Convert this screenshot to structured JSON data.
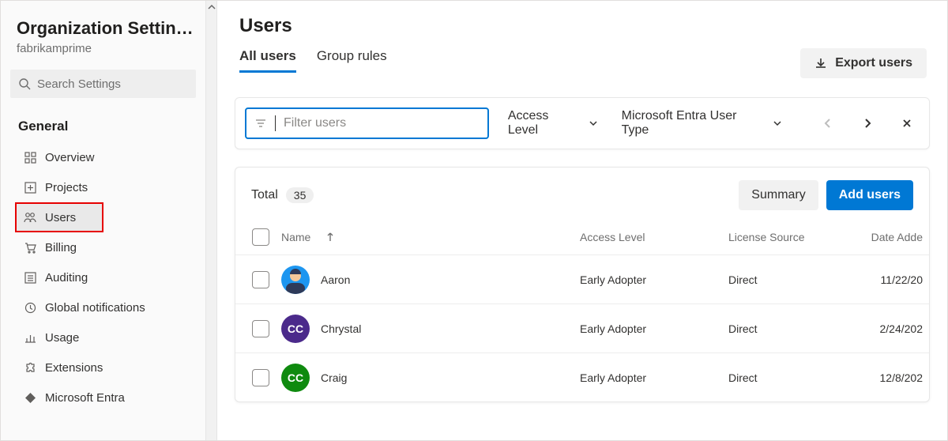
{
  "sidebar": {
    "title": "Organization Settin…",
    "subtitle": "fabrikamprime",
    "search_placeholder": "Search Settings",
    "section_label": "General",
    "items": [
      {
        "label": "Overview",
        "icon": "grid"
      },
      {
        "label": "Projects",
        "icon": "plus-box"
      },
      {
        "label": "Users",
        "icon": "people",
        "selected": true
      },
      {
        "label": "Billing",
        "icon": "cart"
      },
      {
        "label": "Auditing",
        "icon": "list"
      },
      {
        "label": "Global notifications",
        "icon": "clock"
      },
      {
        "label": "Usage",
        "icon": "bar-chart"
      },
      {
        "label": "Extensions",
        "icon": "puzzle"
      },
      {
        "label": "Microsoft Entra",
        "icon": "diamond"
      }
    ]
  },
  "page": {
    "title": "Users",
    "tabs": [
      {
        "label": "All users",
        "active": true
      },
      {
        "label": "Group rules"
      }
    ],
    "export_label": "Export users"
  },
  "filter": {
    "placeholder": "Filter users",
    "access_level_label": "Access Level",
    "entra_label": "Microsoft Entra User Type"
  },
  "table": {
    "total_label": "Total",
    "total_count": "35",
    "summary_label": "Summary",
    "add_label": "Add users",
    "columns": {
      "name": "Name",
      "access": "Access Level",
      "source": "License Source",
      "date": "Date Adde"
    },
    "rows": [
      {
        "name": "Aaron",
        "access": "Early Adopter",
        "source": "Direct",
        "date": "11/22/20",
        "avatar_kind": "img",
        "avatar_color": "#1d96f0",
        "initials": ""
      },
      {
        "name": "Chrystal",
        "access": "Early Adopter",
        "source": "Direct",
        "date": "2/24/202",
        "avatar_kind": "init",
        "avatar_color": "#4b2a8b",
        "initials": "CC"
      },
      {
        "name": "Craig",
        "access": "Early Adopter",
        "source": "Direct",
        "date": "12/8/202",
        "avatar_kind": "init",
        "avatar_color": "#0f8a0f",
        "initials": "CC"
      }
    ]
  }
}
